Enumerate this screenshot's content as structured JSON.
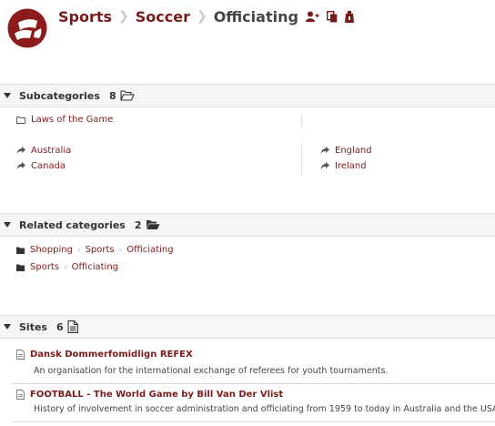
{
  "header": {
    "breadcrumb": [
      "Sports",
      "Soccer"
    ],
    "current": "Officiating",
    "actions": [
      {
        "icon": "add-user-icon"
      },
      {
        "icon": "copy-icon"
      },
      {
        "icon": "suggest-icon"
      }
    ]
  },
  "subcategories": {
    "title": "Subcategories",
    "count": "8",
    "items": [
      "Laws of the Game"
    ],
    "related_left": [
      "Australia",
      "Canada"
    ],
    "related_right": [
      "England",
      "Ireland"
    ]
  },
  "related": {
    "title": "Related categories",
    "count": "2",
    "rows": [
      [
        "Shopping",
        "Sports",
        "Officiating"
      ],
      [
        "Sports",
        "Officiating"
      ]
    ]
  },
  "sites": {
    "title": "Sites",
    "count": "6",
    "items": [
      {
        "title": "Dansk Dommerfomidlign REFEX",
        "desc": "An organisation for the international exchange of referees for youth tournaments."
      },
      {
        "title": "FOOTBALL - The World Game by Bill Van Der Vlist",
        "desc": "History of involvement in soccer administration and officiating from 1959 to today in Australia and the USA."
      }
    ]
  },
  "colors": {
    "accent": "#7a1b1b",
    "section_bg": "#f6f6f6"
  }
}
